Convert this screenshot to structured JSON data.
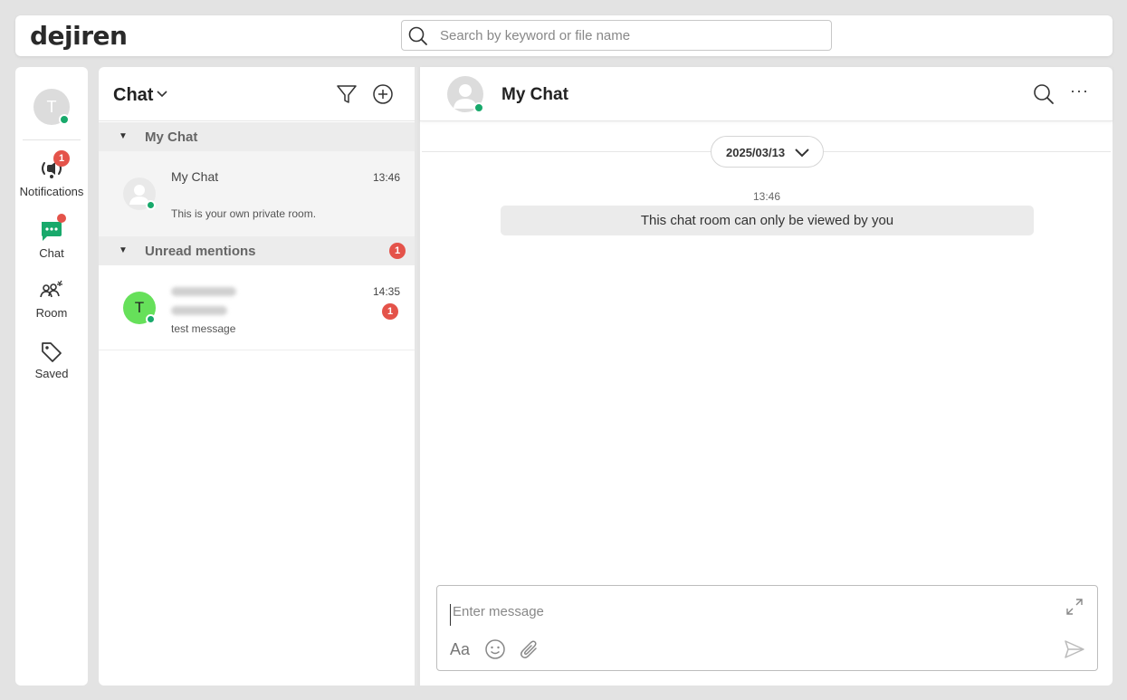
{
  "app": {
    "logo": "dejiren",
    "search_placeholder": "Search by keyword or file name"
  },
  "user": {
    "initial": "T",
    "status_color": "#18a96b"
  },
  "nav": {
    "items": [
      {
        "label": "Notifications",
        "icon": "notification-broadcast-icon",
        "badge": "1"
      },
      {
        "label": "Chat",
        "icon": "chat-bubble-icon",
        "has_dot": true
      },
      {
        "label": "Room",
        "icon": "room-group-icon"
      },
      {
        "label": "Saved",
        "icon": "tag-icon"
      }
    ]
  },
  "chat_list": {
    "title": "Chat",
    "sections": [
      {
        "label": "My Chat",
        "rooms": [
          {
            "name": "My Chat",
            "time": "13:46",
            "preview": "This is your own private room."
          }
        ]
      },
      {
        "label": "Unread mentions",
        "badge": "1",
        "rooms": [
          {
            "initial": "T",
            "time": "14:35",
            "badge": "1",
            "preview": "test message",
            "avatar_color": "#66e05a"
          }
        ]
      }
    ]
  },
  "conversation": {
    "title": "My Chat",
    "date": "2025/03/13",
    "messages": [
      {
        "time": "13:46",
        "text": "This chat room can only be viewed by you"
      }
    ],
    "composer_placeholder": "Enter message",
    "format_label": "Aa"
  },
  "colors": {
    "accent_green": "#18a96b",
    "badge_red": "#e4534a",
    "chat_icon_green": "#18a96b"
  }
}
